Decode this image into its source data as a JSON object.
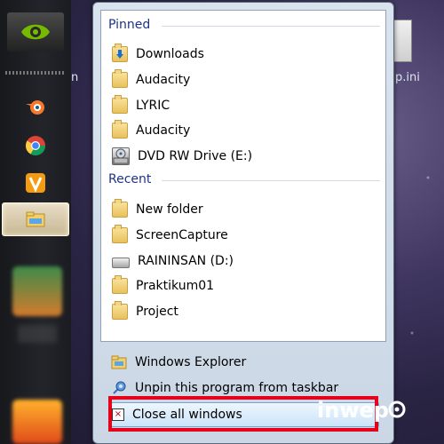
{
  "desktop": {
    "left_fragment": "n",
    "right_fragment": "p.ini"
  },
  "taskbar": {
    "icons": [
      "nvidia-icon",
      "blender-icon",
      "chrome-icon",
      "vivaldi-icon",
      "windows-explorer-icon"
    ]
  },
  "jumplist": {
    "pinned_title": "Pinned",
    "pinned": [
      {
        "label": "Downloads",
        "icon": "downloads-folder-icon"
      },
      {
        "label": "Audacity",
        "icon": "folder-icon"
      },
      {
        "label": "LYRIC",
        "icon": "folder-icon"
      },
      {
        "label": "Audacity",
        "icon": "folder-icon"
      },
      {
        "label": "DVD RW Drive (E:)",
        "icon": "dvd-drive-icon"
      }
    ],
    "recent_title": "Recent",
    "recent": [
      {
        "label": "New folder",
        "icon": "folder-icon"
      },
      {
        "label": "ScreenCapture",
        "icon": "folder-icon"
      },
      {
        "label": "RAININSAN (D:)",
        "icon": "drive-icon"
      },
      {
        "label": "Praktikum01",
        "icon": "folder-icon"
      },
      {
        "label": "Project",
        "icon": "folder-icon"
      }
    ],
    "tasks": [
      {
        "label": "Windows Explorer",
        "icon": "windows-explorer-icon"
      },
      {
        "label": "Unpin this program from taskbar",
        "icon": "unpin-icon"
      },
      {
        "label": "Close all windows",
        "icon": "close-window-icon"
      }
    ]
  },
  "highlight_color": "#e6001a",
  "accent_color": "#1e3287"
}
